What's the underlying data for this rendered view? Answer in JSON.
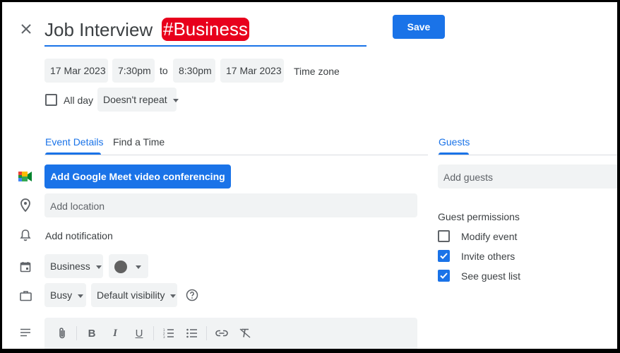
{
  "title": {
    "main": "Job Interview",
    "tag": "#Business"
  },
  "save_label": "Save",
  "datetime": {
    "start_date": "17 Mar 2023",
    "start_time": "7:30pm",
    "to_label": "to",
    "end_time": "8:30pm",
    "end_date": "17 Mar 2023",
    "timezone": "Time zone"
  },
  "allday_label": "All day",
  "repeat_value": "Doesn't repeat",
  "tabs": {
    "details": "Event Details",
    "find_time": "Find a Time",
    "guests": "Guests"
  },
  "meet_button": "Add Google Meet video conferencing",
  "location_placeholder": "Add location",
  "add_notification": "Add notification",
  "calendar_value": "Business",
  "busy_value": "Busy",
  "visibility_value": "Default visibility",
  "guests": {
    "placeholder": "Add guests",
    "permissions_title": "Guest permissions",
    "permissions": [
      {
        "label": "Modify event",
        "checked": false
      },
      {
        "label": "Invite others",
        "checked": true
      },
      {
        "label": "See guest list",
        "checked": true
      }
    ]
  },
  "colors": {
    "accent": "#1a73e8",
    "tag_bg": "#e8001c",
    "chip_bg": "#f1f3f4"
  },
  "icons": [
    "close-icon",
    "google-meet-icon",
    "location-pin-icon",
    "bell-icon",
    "calendar-icon",
    "briefcase-icon",
    "notes-icon",
    "attachment-icon",
    "bold-icon",
    "italic-icon",
    "underline-icon",
    "numbered-list-icon",
    "bullet-list-icon",
    "link-icon",
    "clear-format-icon",
    "help-icon",
    "color-dot-icon"
  ]
}
